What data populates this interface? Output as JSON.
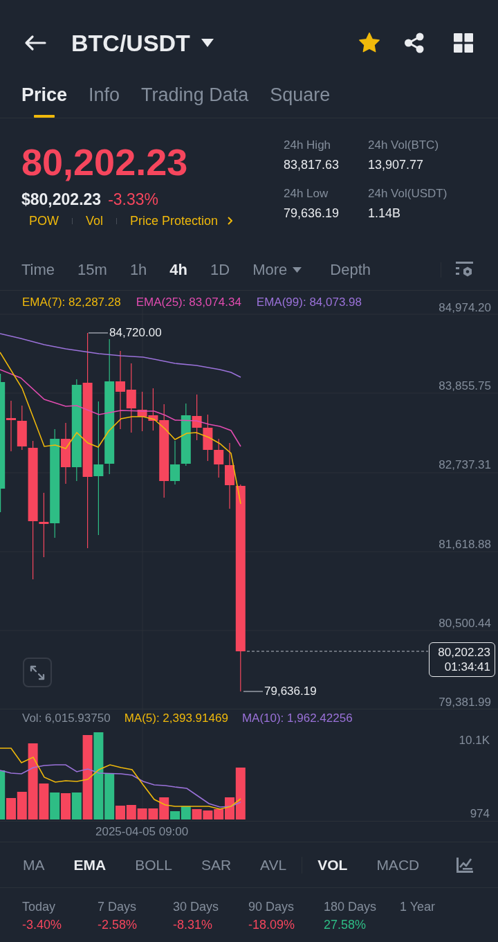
{
  "header": {
    "title": "BTC/USDT",
    "favorite": true
  },
  "tabs": [
    {
      "label": "Price",
      "selected": true
    },
    {
      "label": "Info",
      "selected": false
    },
    {
      "label": "Trading Data",
      "selected": false
    },
    {
      "label": "Square",
      "selected": false
    }
  ],
  "ticker": {
    "price": "80,202.23",
    "price_usd": "$80,202.23",
    "change": "-3.33%",
    "negative": true,
    "tags": [
      {
        "label": "POW",
        "arrow": false
      },
      {
        "label": "Vol",
        "arrow": false
      },
      {
        "label": "Price Protection",
        "arrow": true
      }
    ]
  },
  "stats": [
    {
      "label": "24h High",
      "value": "83,817.63"
    },
    {
      "label": "24h Vol(BTC)",
      "value": "13,907.77"
    },
    {
      "label": "24h Low",
      "value": "79,636.19"
    },
    {
      "label": "24h Vol(USDT)",
      "value": "1.14B"
    }
  ],
  "intervals": [
    {
      "label": "Time",
      "selected": false,
      "dropdown": false
    },
    {
      "label": "15m",
      "selected": false,
      "dropdown": false
    },
    {
      "label": "1h",
      "selected": false,
      "dropdown": false
    },
    {
      "label": "4h",
      "selected": true,
      "dropdown": false
    },
    {
      "label": "1D",
      "selected": false,
      "dropdown": false
    },
    {
      "label": "More",
      "selected": false,
      "dropdown": true
    },
    {
      "label": "Depth",
      "selected": false,
      "dropdown": false
    }
  ],
  "chart": {
    "legend": [
      {
        "label": "EMA(7): 82,287.28",
        "color": "#f0b90b"
      },
      {
        "label": "EMA(25): 83,074.34",
        "color": "#e14cb0"
      },
      {
        "label": "EMA(99): 84,073.98",
        "color": "#9b72da"
      }
    ],
    "y_ticks": [
      "84,974.20",
      "83,855.75",
      "82,737.31",
      "81,618.88",
      "80,500.44",
      "79,381.99"
    ],
    "high": "84,720.00",
    "low": "79,636.19",
    "last_price": "80,202.23",
    "countdown": "01:34:41"
  },
  "volume": {
    "legend": [
      {
        "label": "Vol: 6,015.93750",
        "color": "#848e9c"
      },
      {
        "label": "MA(5): 2,393.91469",
        "color": "#f0b90b"
      },
      {
        "label": "MA(10): 1,962.42256",
        "color": "#9b72da"
      }
    ],
    "y_ticks": [
      "10.1K",
      "974"
    ],
    "time_label": "2025-04-05 09:00"
  },
  "indicators": {
    "main": [
      {
        "label": "MA",
        "selected": false
      },
      {
        "label": "EMA",
        "selected": true
      },
      {
        "label": "BOLL",
        "selected": false
      },
      {
        "label": "SAR",
        "selected": false
      },
      {
        "label": "AVL",
        "selected": false
      }
    ],
    "sub": [
      {
        "label": "VOL",
        "selected": true
      },
      {
        "label": "MACD",
        "selected": false
      }
    ]
  },
  "performance": [
    {
      "period": "Today",
      "change": "-3.40%",
      "negative": true
    },
    {
      "period": "7 Days",
      "change": "-2.58%",
      "negative": true
    },
    {
      "period": "30 Days",
      "change": "-8.31%",
      "negative": true
    },
    {
      "period": "90 Days",
      "change": "-18.09%",
      "negative": true
    },
    {
      "period": "180 Days",
      "change": "27.58%",
      "negative": false
    },
    {
      "period": "1 Year"
    }
  ]
}
